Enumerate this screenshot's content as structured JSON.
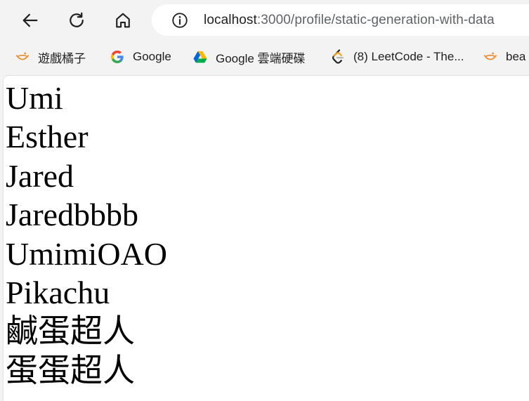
{
  "browser": {
    "address_bar": {
      "host": "localhost",
      "rest": ":3000/profile/static-generation-with-data"
    },
    "bookmarks": [
      {
        "label": "遊戲橘子",
        "icon": "gamania-icon"
      },
      {
        "label": "Google",
        "icon": "google-icon"
      },
      {
        "label": "Google 雲端硬碟",
        "icon": "google-drive-icon"
      },
      {
        "label": "(8) LeetCode - The...",
        "icon": "leetcode-icon"
      },
      {
        "label": "bea",
        "icon": "gamania-icon"
      }
    ]
  },
  "page": {
    "names": [
      "Umi",
      "Esther",
      "Jared",
      "Jaredbbbb",
      "UmimiOAO",
      "Pikachu",
      "鹹蛋超人",
      "蛋蛋超人"
    ]
  },
  "colors": {
    "toolbar_bg": "#f3f3f3",
    "page_bg": "#ffffff",
    "text": "#000000"
  }
}
